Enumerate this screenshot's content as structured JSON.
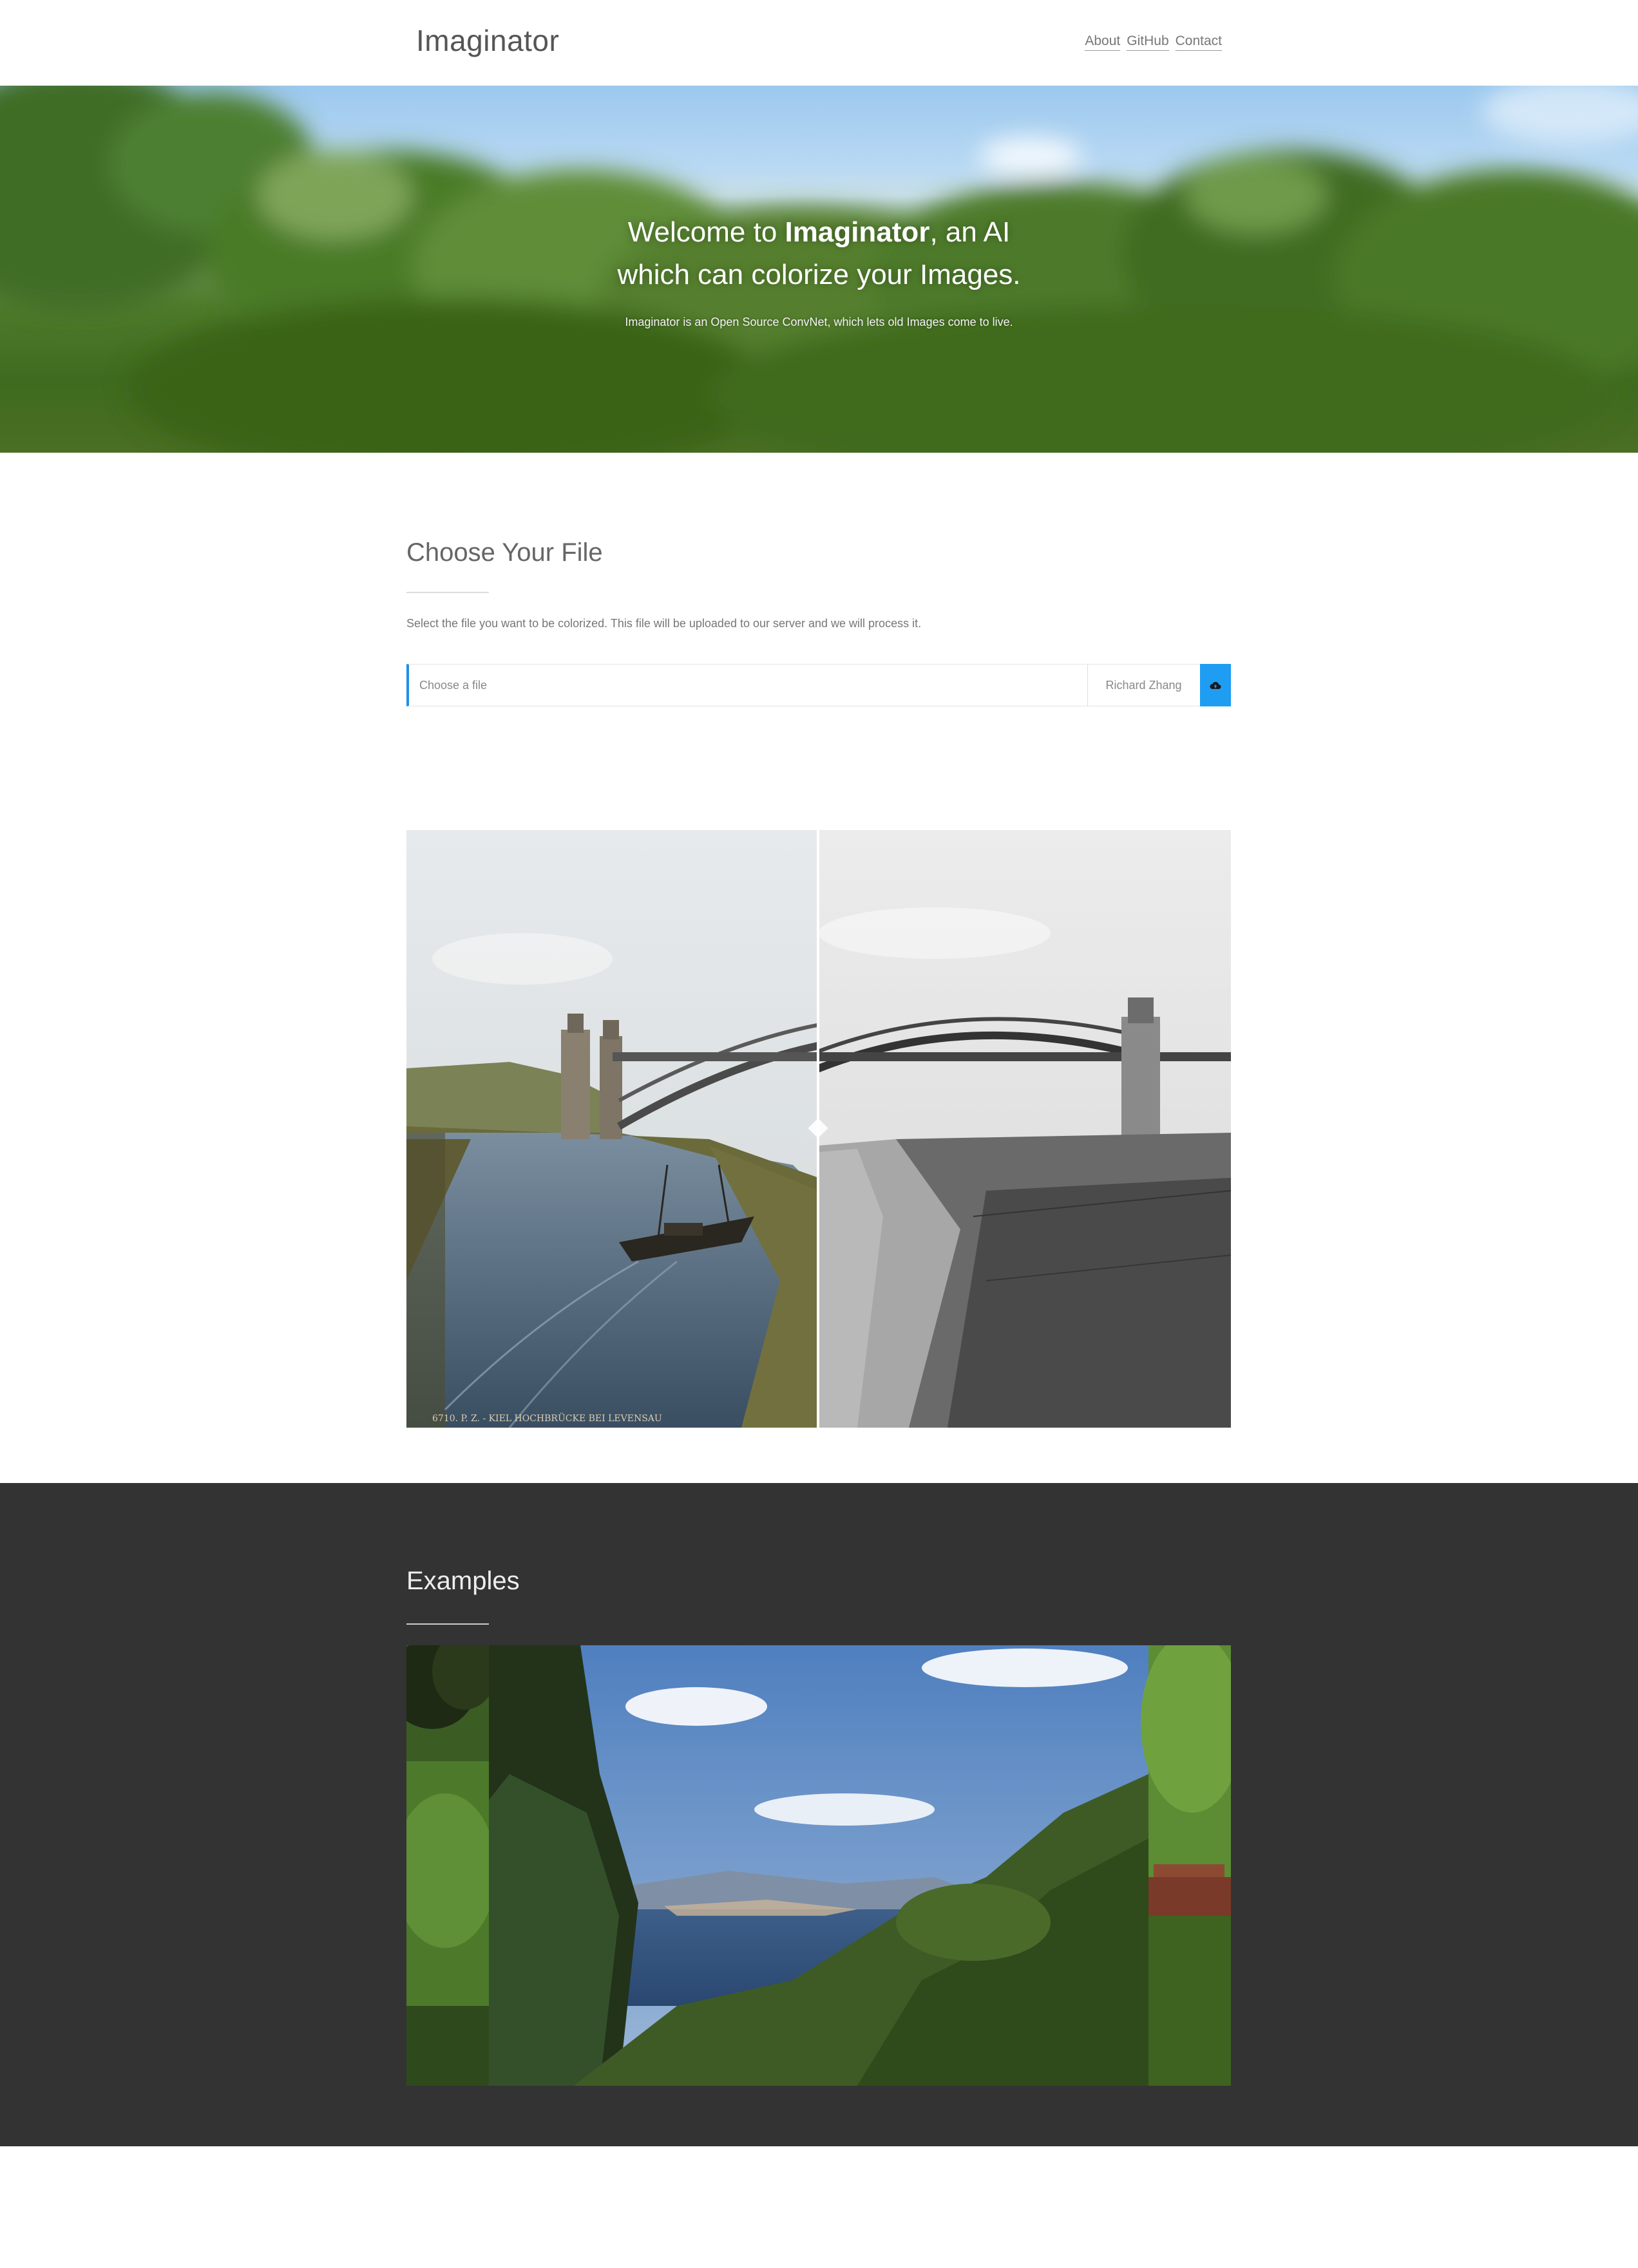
{
  "header": {
    "brand": "Imaginator",
    "nav": [
      "About",
      "GitHub",
      "Contact"
    ]
  },
  "hero": {
    "title_pre": "Welcome to ",
    "title_bold": "Imaginator",
    "title_mid": ", an AI",
    "title_line2": "which can colorize your Images.",
    "subtitle": "Imaginator is an Open Source ConvNet, which lets old Images come to live."
  },
  "upload": {
    "heading": "Choose Your File",
    "description": "Select the file you want to be colorized. This file will be uploaded to our server and we will process it.",
    "placeholder": "Choose a file",
    "file_name": "Richard Zhang",
    "button_icon": "cloud-upload-icon"
  },
  "compare": {
    "caption": "6710. P. Z. - KIEL HOCHBRÜCKE BEI LEVENSAU"
  },
  "examples": {
    "heading": "Examples"
  },
  "colors": {
    "accent": "#1e9df2",
    "dark_section": "#333333"
  }
}
